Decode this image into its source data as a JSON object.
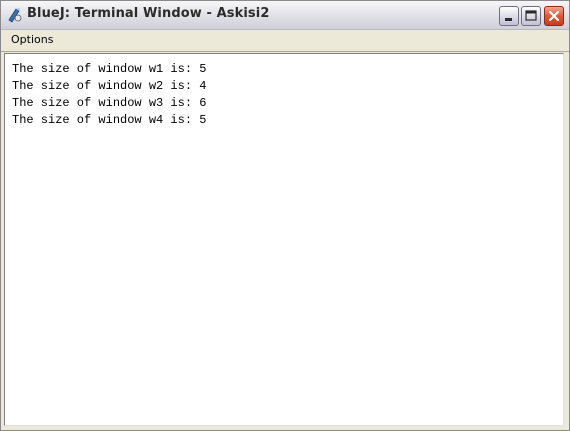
{
  "window": {
    "title": "BlueJ: Terminal Window - Askisi2",
    "icon": "bluej-icon",
    "controls": {
      "minimize": "minimize-icon",
      "maximize": "maximize-icon",
      "close": "close-icon"
    }
  },
  "menu": {
    "options_label": "Options"
  },
  "terminal": {
    "lines": [
      "The size of window w1 is: 5",
      "The size of window w2 is: 4",
      "The size of window w3 is: 6",
      "The size of window w4 is: 5"
    ]
  },
  "colors": {
    "close_button": "#dd5a38",
    "chrome": "#ece9d8",
    "terminal_background": "#ffffff"
  }
}
